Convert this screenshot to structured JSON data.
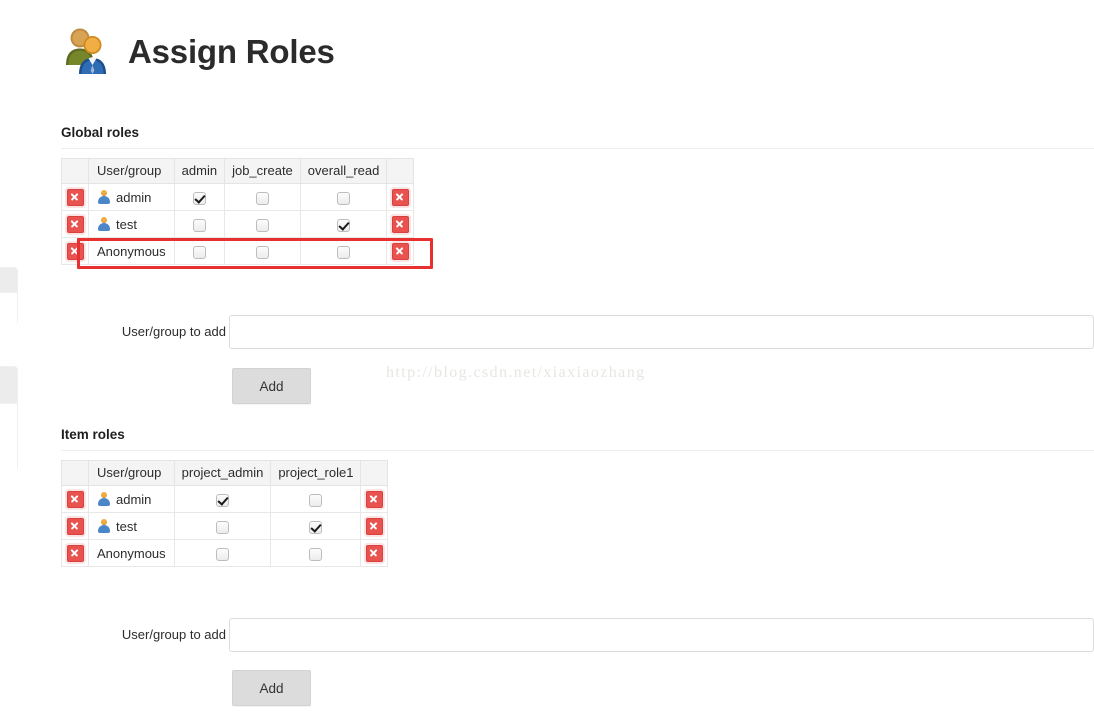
{
  "page": {
    "title": "Assign Roles",
    "header_icon": "users-group-icon"
  },
  "watermark": {
    "text": "http://blog.csdn.net/xiaxiaozhang"
  },
  "colors": {
    "highlight_red": "#e83030",
    "delete_icon_red": "#e8534f",
    "table_header_bg": "#f4f4f4",
    "button_bg": "#dcdcdc"
  },
  "global_roles": {
    "heading": "Global roles",
    "columns": [
      "User/group",
      "admin",
      "job_create",
      "overall_read"
    ],
    "rows": [
      {
        "name": "admin",
        "has_person_icon": true,
        "checks": [
          true,
          false,
          false
        ],
        "delete_left": "delete-icon",
        "delete_right": "delete-icon",
        "highlighted": false
      },
      {
        "name": "test",
        "has_person_icon": true,
        "checks": [
          false,
          false,
          true
        ],
        "delete_left": "delete-icon",
        "delete_right": "delete-icon",
        "highlighted": false
      },
      {
        "name": "Anonymous",
        "has_person_icon": false,
        "checks": [
          false,
          false,
          false
        ],
        "delete_left": "delete-icon",
        "delete_right": "delete-icon",
        "highlighted": true
      }
    ],
    "add_form": {
      "label": "User/group to add",
      "value": "",
      "placeholder": "",
      "button_label": "Add"
    }
  },
  "item_roles": {
    "heading": "Item roles",
    "columns": [
      "User/group",
      "project_admin",
      "project_role1"
    ],
    "rows": [
      {
        "name": "admin",
        "has_person_icon": true,
        "checks": [
          true,
          false
        ],
        "delete_left": "delete-icon",
        "delete_right": "delete-icon",
        "highlighted": false
      },
      {
        "name": "test",
        "has_person_icon": true,
        "checks": [
          false,
          true
        ],
        "delete_left": "delete-icon",
        "delete_right": "delete-icon",
        "highlighted": false
      },
      {
        "name": "Anonymous",
        "has_person_icon": false,
        "checks": [
          false,
          false
        ],
        "delete_left": "delete-icon",
        "delete_right": "delete-icon",
        "highlighted": false
      }
    ],
    "add_form": {
      "label": "User/group to add",
      "value": "",
      "placeholder": "",
      "button_label": "Add"
    }
  }
}
